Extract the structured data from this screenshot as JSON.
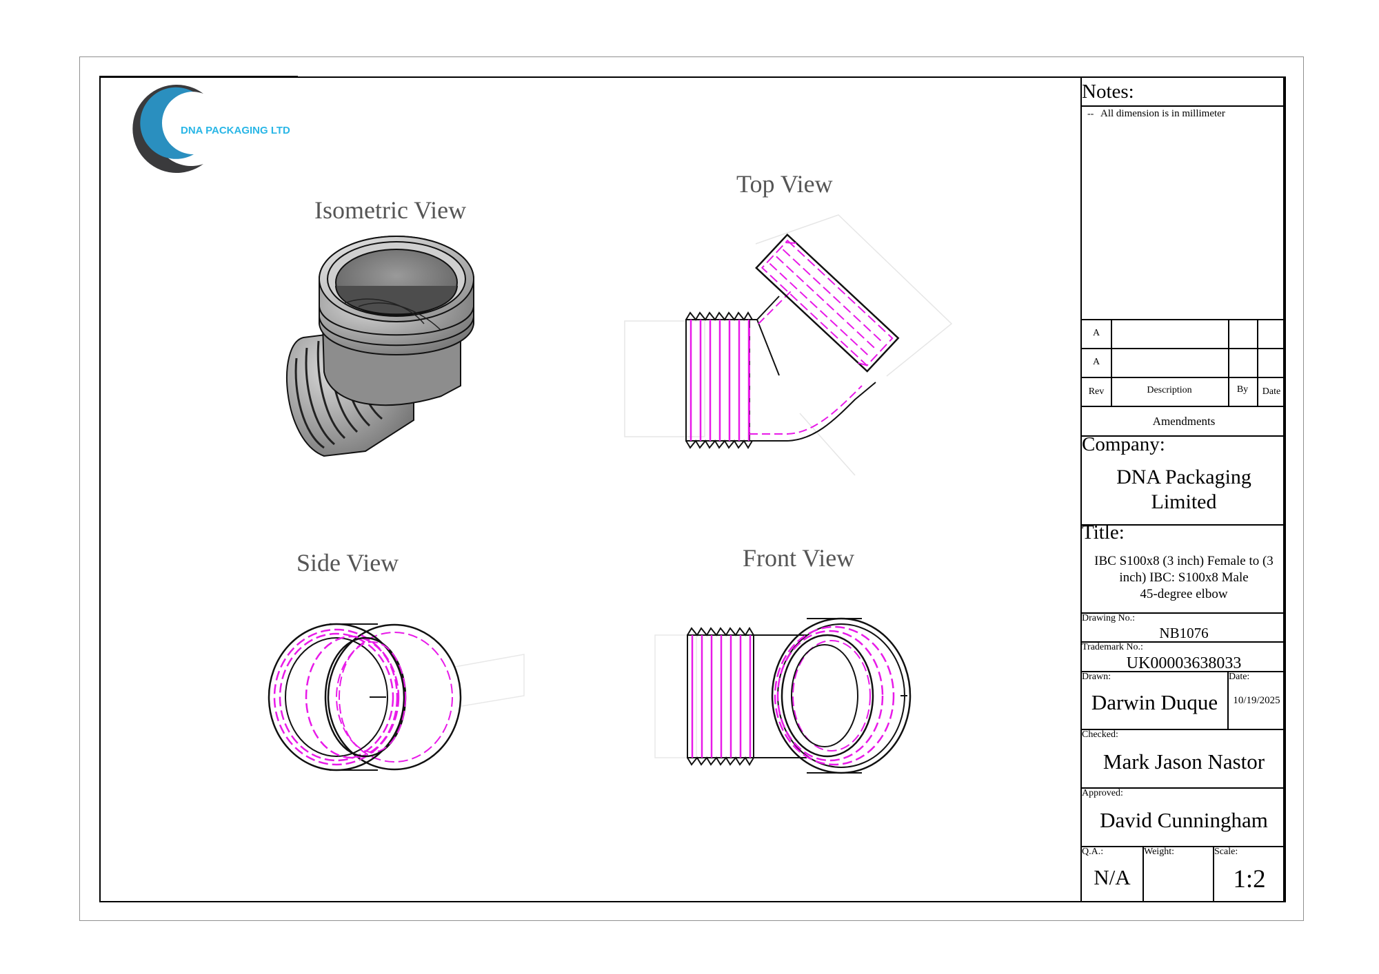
{
  "logo": {
    "text": "DNA PACKAGING LTD",
    "colors": {
      "dark": "#3a3a3c",
      "blue": "#2a8fbf",
      "orange": "#f39a1f",
      "text": "#29b6e6"
    }
  },
  "views": {
    "isometric": "Isometric View",
    "top": "Top View",
    "side": "Side View",
    "front": "Front View"
  },
  "colors": {
    "hidden": "#e81ae8",
    "line": "#111111",
    "label": "#555555"
  },
  "title_block": {
    "notes_heading": "Notes:",
    "notes_marker": "--",
    "notes_line": "All dimension is in millimeter",
    "rev_rows": [
      "A",
      "A"
    ],
    "rev_header": {
      "rev": "Rev",
      "description": "Description",
      "by": "By",
      "date": "Date"
    },
    "amendments": "Amendments",
    "company_label": "Company:",
    "company_line1": "DNA Packaging",
    "company_line2": "Limited",
    "title_label": "Title:",
    "title_line1": "IBC S100x8 (3 inch) Female to (3",
    "title_line2": "inch) IBC: S100x8 Male",
    "title_line3": "45-degree elbow",
    "drawing_no_label": "Drawing No.:",
    "drawing_no": "NB1076",
    "trademark_label": "Trademark No.:",
    "trademark_no": "UK00003638033",
    "drawn_label": "Drawn:",
    "drawn_by": "Darwin Duque",
    "date_label": "Date:",
    "date": "10/19/2025",
    "checked_label": "Checked:",
    "checked_by": "Mark Jason Nastor",
    "approved_label": "Approved:",
    "approved_by": "David Cunningham",
    "qa_label": "Q.A.:",
    "qa": "N/A",
    "weight_label": "Weight:",
    "scale_label": "Scale:",
    "scale": "1:2"
  }
}
